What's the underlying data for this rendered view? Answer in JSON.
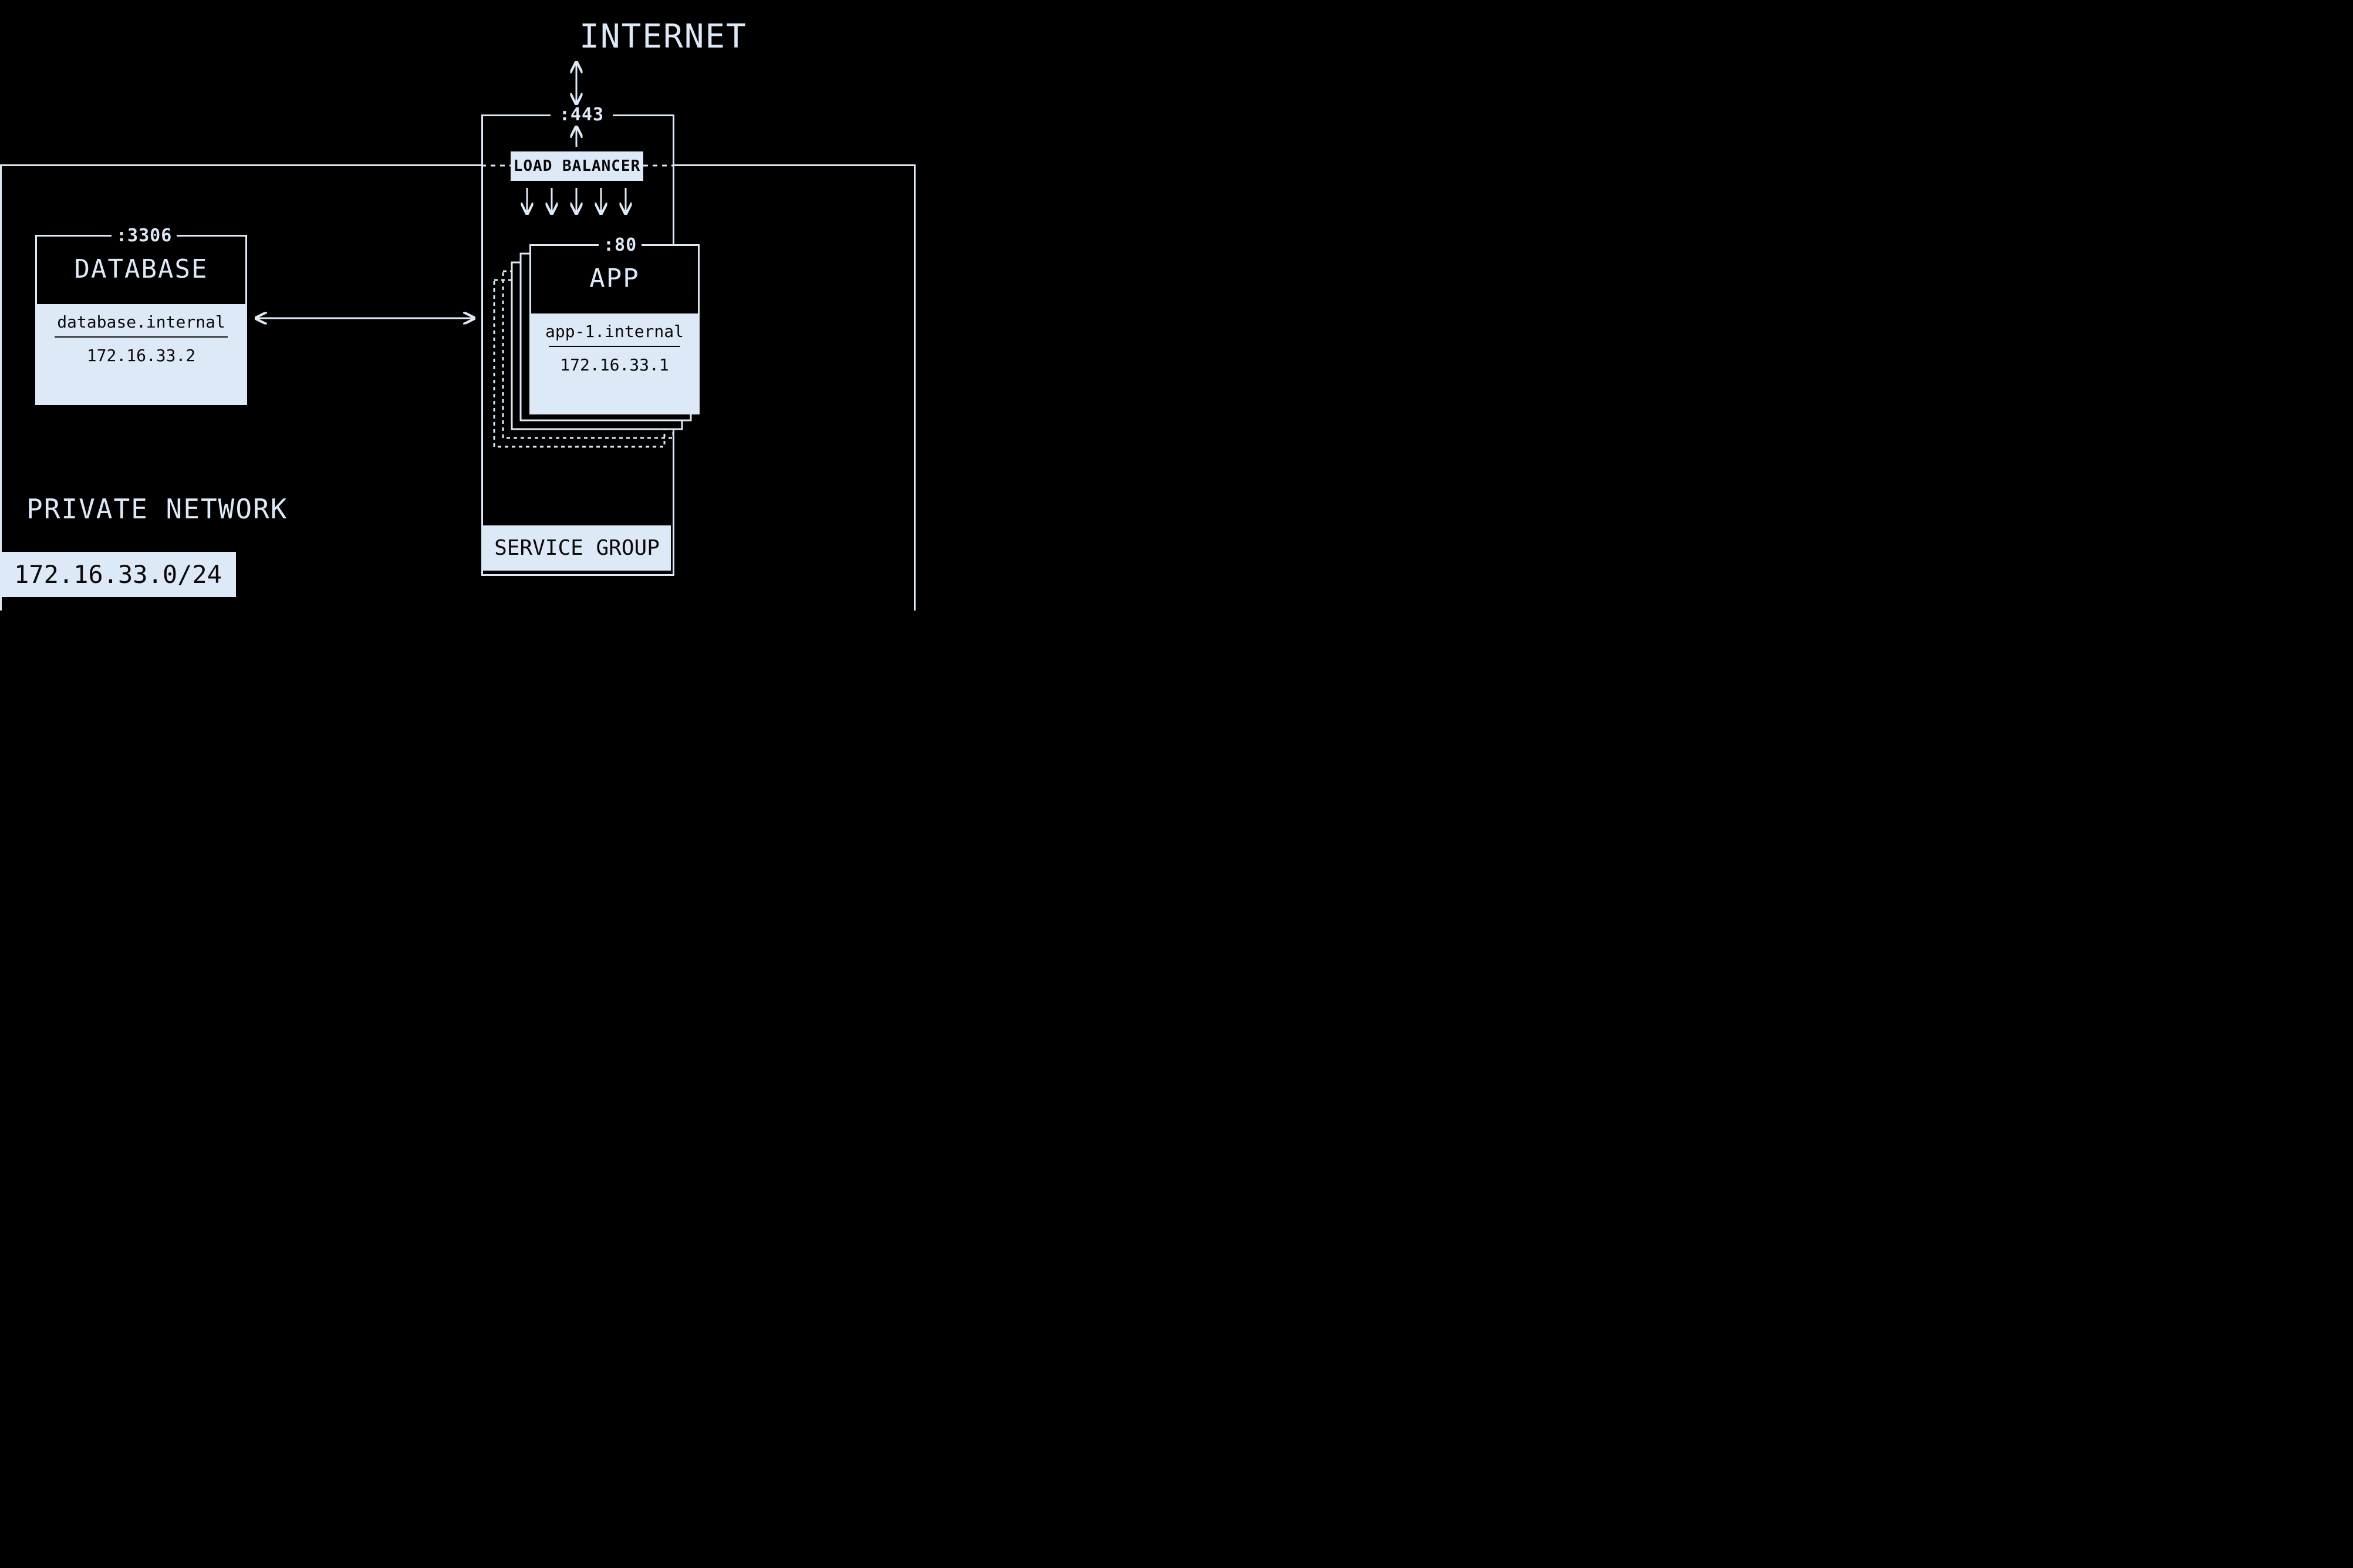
{
  "internet_label": "INTERNET",
  "private_network": {
    "label": "PRIVATE NETWORK",
    "cidr": "172.16.33.0/24"
  },
  "service_group": {
    "label": "SERVICE GROUP",
    "port": ":443",
    "load_balancer_label": "LOAD BALANCER",
    "app": {
      "port": ":80",
      "title": "APP",
      "hostname": "app-1.internal",
      "ip": "172.16.33.1"
    }
  },
  "database": {
    "port": ":3306",
    "title": "DATABASE",
    "hostname": "database.internal",
    "ip": "172.16.33.2"
  }
}
